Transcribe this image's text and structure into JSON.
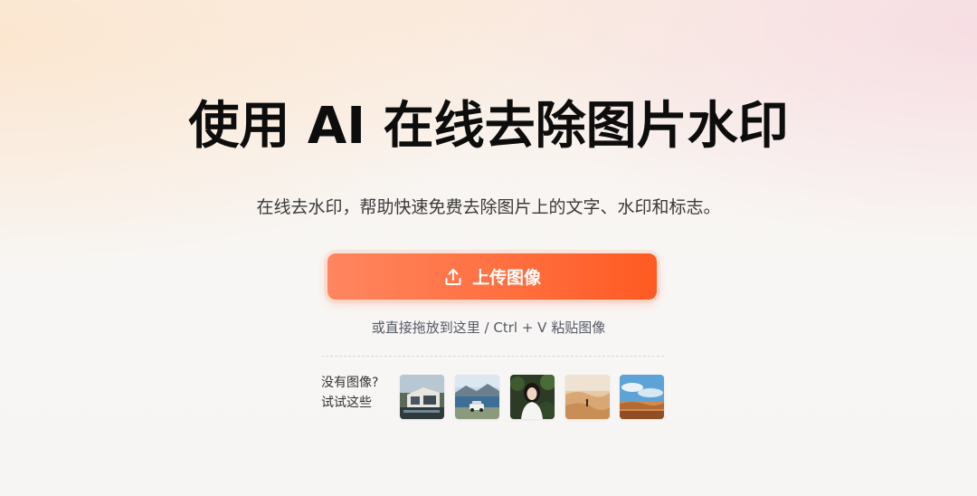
{
  "hero": {
    "title": "使用 AI 在线去除图片水印",
    "subtitle": "在线去水印，帮助快速免费去除图片上的文字、水印和标志。"
  },
  "upload": {
    "button_label": "上传图像",
    "icon": "upload-icon",
    "drop_hint": "或直接拖放到这里 / Ctrl + V 粘贴图像"
  },
  "samples": {
    "label_line1": "没有图像?",
    "label_line2": "试试这些",
    "items": [
      {
        "name": "sample-house-photo"
      },
      {
        "name": "sample-lake-car-photo"
      },
      {
        "name": "sample-woman-portrait-photo"
      },
      {
        "name": "sample-desert-photo"
      },
      {
        "name": "sample-sky-landscape-photo"
      }
    ]
  },
  "colors": {
    "accent_start": "#ff8660",
    "accent_end": "#ff5a22",
    "title": "#0d0d0d",
    "subtitle": "#3a3a3a",
    "hint": "#555a66"
  }
}
